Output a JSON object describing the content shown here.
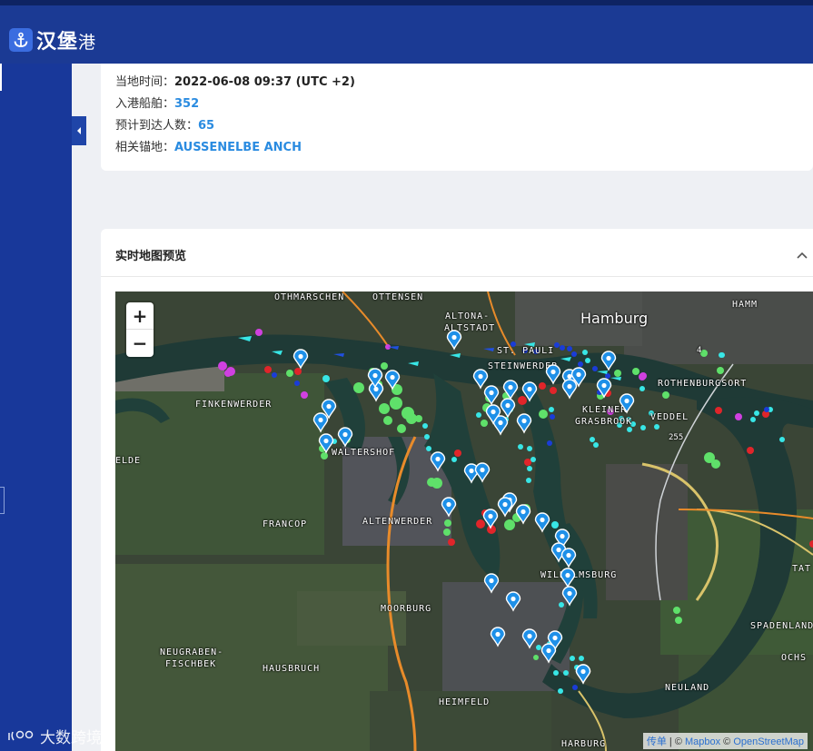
{
  "header": {
    "title_main": "汉堡",
    "title_suffix": "港",
    "logo_icon": "anchor-icon"
  },
  "info": {
    "rows": [
      {
        "label": "当地时间：",
        "value": "2022-06-08 09:37 (UTC +2)"
      },
      {
        "label": "入港船舶：",
        "value": "352"
      },
      {
        "label": "预计到达人数：",
        "value": "65"
      },
      {
        "label": "相关锚地：",
        "value": "AUSSENELBE ANCH"
      }
    ]
  },
  "map_card": {
    "title": "实时地图预览"
  },
  "map": {
    "zoom_in": "+",
    "zoom_out": "−",
    "attribution": {
      "prefix": "传单",
      "sep1": " | © ",
      "mapbox": "Mapbox",
      "sep2": " © ",
      "osm": "OpenStreetMap"
    },
    "places": [
      "OTHMARSCHEN",
      "OTTENSEN",
      "ALTONA-",
      "ALTSTADT",
      "Hamburg",
      "HAMM",
      "ST. PAULI",
      "STEINWERDER",
      "ROTHENBURGSORT",
      "FINKENWERDER",
      "KLEINER",
      "GRASBROOK",
      "VEDDEL",
      "WALTERSHOF",
      "ELDE",
      "FRANCOP",
      "ALTENWERDER",
      "WILHELMSBURG",
      "TAT",
      "SPADENLAND",
      "OCHS",
      "MOORBURG",
      "NEUGRABEN-",
      "FISCHBEK",
      "HAUSBRUCH",
      "NEULAND",
      "HEIMFELD",
      "HARBURG",
      "255",
      "4"
    ]
  },
  "watermark": "大数跨境",
  "colors": {
    "header_bg": "#1b3a94",
    "sidebar_bg": "#18389a",
    "link_blue": "#2a8be0",
    "ship_green": "#5fe06a",
    "ship_red": "#e0252a",
    "ship_cyan": "#38e6e6",
    "ship_magenta": "#d040e0",
    "ship_blue": "#1a3cd8",
    "pin_blue": "#1e90e8"
  }
}
